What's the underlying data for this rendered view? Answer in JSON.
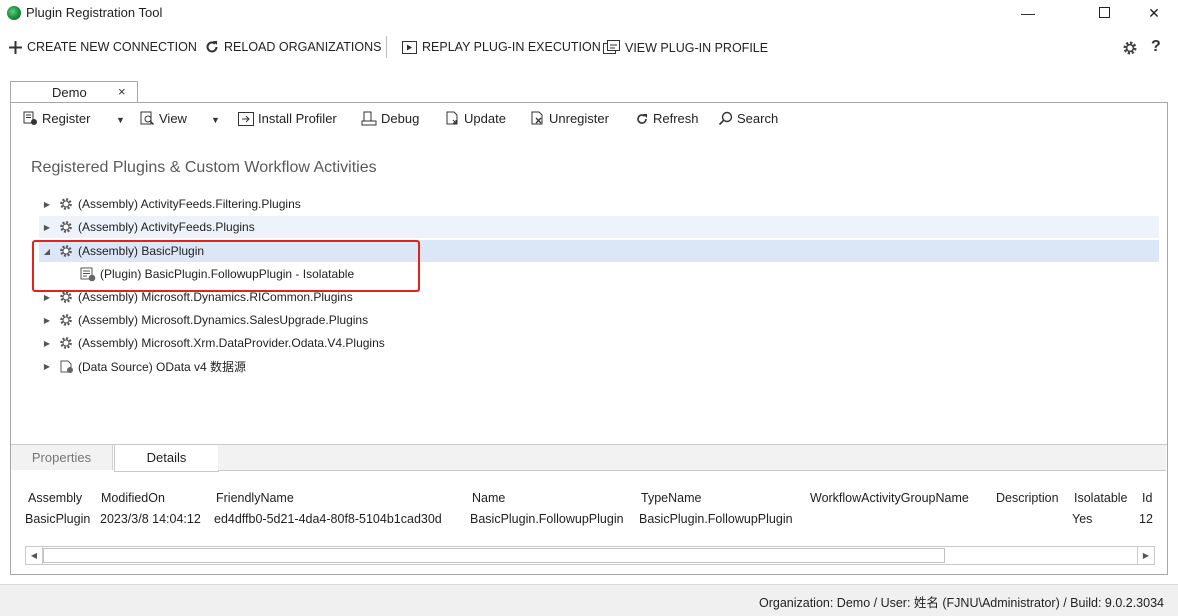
{
  "window": {
    "title": "Plugin Registration Tool",
    "min": "—",
    "close": "✕"
  },
  "commands": {
    "create": "CREATE NEW CONNECTION",
    "reload": "RELOAD ORGANIZATIONS",
    "replay": "REPLAY PLUG-IN EXECUTION",
    "profile": "VIEW PLUG-IN PROFILE",
    "help": "?"
  },
  "doc_tab": {
    "label": "Demo",
    "close": "×"
  },
  "toolbar": {
    "register": "Register",
    "view": "View",
    "install_profiler": "Install Profiler",
    "debug": "Debug",
    "update": "Update",
    "unregister": "Unregister",
    "refresh": "Refresh",
    "search": "Search"
  },
  "section_heading": "Registered Plugins & Custom Workflow Activities",
  "tree": {
    "items": [
      {
        "text": "(Assembly) ActivityFeeds.Filtering.Plugins"
      },
      {
        "text": "(Assembly) ActivityFeeds.Plugins"
      },
      {
        "text": "(Assembly) BasicPlugin"
      },
      {
        "text": "(Plugin) BasicPlugin.FollowupPlugin - Isolatable"
      },
      {
        "text": "(Assembly) Microsoft.Dynamics.RICommon.Plugins"
      },
      {
        "text": "(Assembly) Microsoft.Dynamics.SalesUpgrade.Plugins"
      },
      {
        "text": "(Assembly) Microsoft.Xrm.DataProvider.Odata.V4.Plugins"
      },
      {
        "text": "(Data Source) OData v4 数据源"
      }
    ]
  },
  "bottom_tabs": {
    "properties": "Properties",
    "details": "Details"
  },
  "details": {
    "headers": [
      "Assembly",
      "ModifiedOn",
      "FriendlyName",
      "Name",
      "TypeName",
      "WorkflowActivityGroupName",
      "Description",
      "Isolatable",
      "Id"
    ],
    "row": [
      "BasicPlugin",
      "2023/3/8 14:04:12",
      "ed4dffb0-5d21-4da4-80f8-5104b1cad30d",
      "BasicPlugin.FollowupPlugin",
      "BasicPlugin.FollowupPlugin",
      "",
      "",
      "Yes",
      "12"
    ]
  },
  "status": "Organization: Demo / User: 姓名 (FJNU\\Administrator) / Build: 9.0.2.3034",
  "colors": {
    "highlight": "#e2231a",
    "selected_row": "#dbe6f6",
    "alt_row": "#eef3fb"
  }
}
